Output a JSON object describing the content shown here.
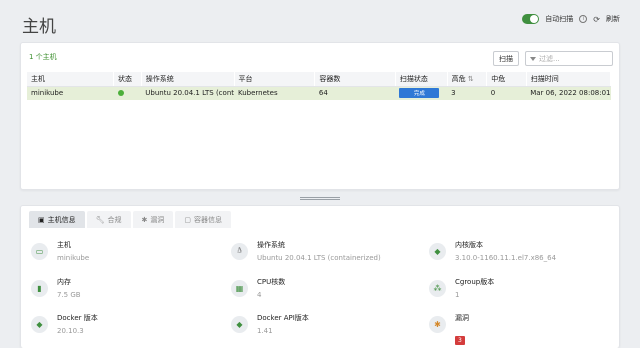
{
  "page": {
    "title": "主机"
  },
  "toolbar": {
    "auto_scan_label": "自动扫描",
    "refresh_label": "刷新",
    "auto_scan_on": true
  },
  "hosts_panel": {
    "count_label": "1 个主机",
    "scan_button": "扫描",
    "filter_placeholder": "过滤..."
  },
  "table": {
    "columns": [
      "主机",
      "状态",
      "操作系统",
      "平台",
      "容器数",
      "扫描状态",
      "高危",
      "中危",
      "扫描时间"
    ],
    "rows": [
      {
        "host": "minikube",
        "status_color": "#4caf3a",
        "os": "Ubuntu 20.04.1 LTS (cont",
        "platform": "Kubernetes",
        "containers": "64",
        "scan_status": "完成",
        "high": "3",
        "medium": "0",
        "scan_time": "Mar 06, 2022 08:08:01"
      }
    ]
  },
  "tabs": [
    {
      "label": "主机信息",
      "icon": "id-card-icon",
      "active": true
    },
    {
      "label": "合规",
      "icon": "wrench-icon",
      "active": false
    },
    {
      "label": "漏洞",
      "icon": "bug-icon",
      "active": false
    },
    {
      "label": "容器信息",
      "icon": "container-icon",
      "active": false
    }
  ],
  "info": {
    "host": {
      "label": "主机",
      "value": "minikube",
      "icon": "card-icon"
    },
    "os": {
      "label": "操作系统",
      "value": "Ubuntu 20.04.1 LTS (containerized)",
      "icon": "linux-icon"
    },
    "kernel": {
      "label": "内核版本",
      "value": "3.10.0-1160.11.1.el7.x86_64",
      "icon": "tag-icon"
    },
    "memory": {
      "label": "内存",
      "value": "7.5 GB",
      "icon": "memory-icon"
    },
    "cpu": {
      "label": "CPU核数",
      "value": "4",
      "icon": "cpu-icon"
    },
    "cgroup": {
      "label": "Cgroup版本",
      "value": "1",
      "icon": "cgroup-icon"
    },
    "docker": {
      "label": "Docker 版本",
      "value": "20.10.3",
      "icon": "tag-icon"
    },
    "docker_api": {
      "label": "Docker API版本",
      "value": "1.41",
      "icon": "tag-icon"
    },
    "vuln": {
      "label": "漏洞",
      "value": "3",
      "icon": "bug-icon"
    }
  },
  "colors": {
    "accent_green": "#3f8f3f",
    "done_blue": "#2f78d6",
    "vuln_red": "#d43c3c",
    "row_highlight": "#e6efd8"
  }
}
